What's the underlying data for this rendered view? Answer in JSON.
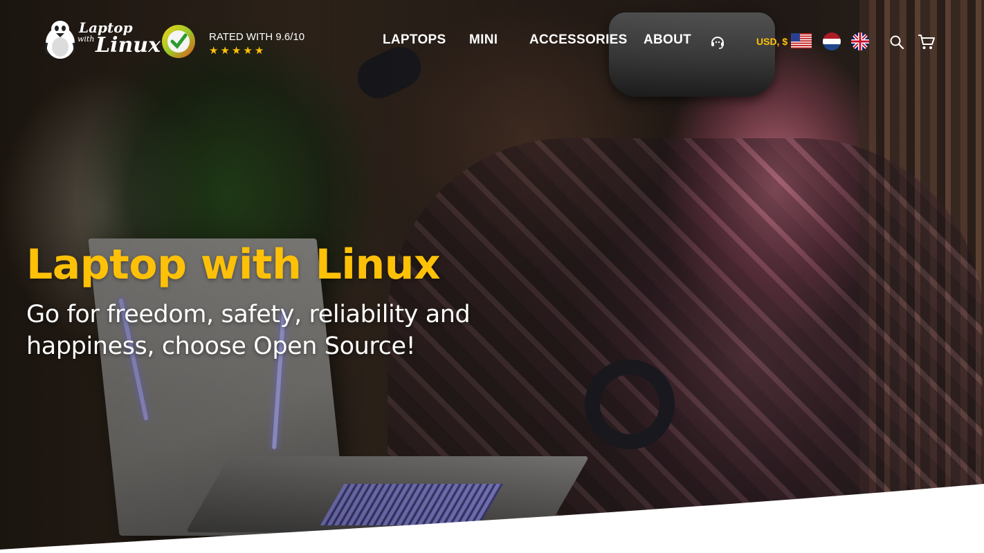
{
  "brand": {
    "logo_line1": "Laptop",
    "logo_line2": "with",
    "logo_line3": "Linux"
  },
  "rating": {
    "label": "RATED WITH 9.6/10",
    "stars": 5,
    "stars_display": "★ ★ ★ ★ ★"
  },
  "nav": {
    "items": [
      {
        "label": "LAPTOPS"
      },
      {
        "label": "MINI"
      },
      {
        "label": "ACCESSORIES"
      },
      {
        "label": "ABOUT"
      }
    ]
  },
  "header_tools": {
    "currency_label": "USD, $",
    "icons": [
      "support-headset-icon",
      "flag-us-icon",
      "flag-nl-icon",
      "flag-uk-icon",
      "search-icon",
      "cart-icon"
    ]
  },
  "hero": {
    "title": "Laptop with Linux",
    "subtitle_line1": "Go for freedom, safety, reliability and",
    "subtitle_line2": "happiness, choose Open Source!"
  },
  "colors": {
    "accent": "#ffc107",
    "text_light": "#ffffff",
    "background": "#ffffff"
  }
}
